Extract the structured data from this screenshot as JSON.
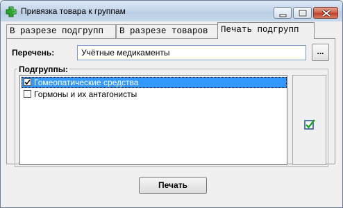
{
  "window": {
    "title": "Привязка товара к группам"
  },
  "tabs": [
    {
      "label": "В разрезе подгрупп"
    },
    {
      "label": "В разрезе товаров"
    },
    {
      "label": "Печать подгрупп",
      "active": true
    }
  ],
  "perechen": {
    "label": "Перечень:",
    "value": "Учётные медикаменты",
    "browse_label": "..."
  },
  "subgroups": {
    "label": "Подгруппы:",
    "items": [
      {
        "label": "Гомеопатические средства",
        "checked": true,
        "selected": true
      },
      {
        "label": "Гормоны и их антагонисты",
        "checked": false,
        "selected": false
      }
    ]
  },
  "print_button": {
    "label": "Печать"
  },
  "colors": {
    "selection": "#3399ff",
    "close_button": "#c0412a",
    "app_icon": "#2aa52a"
  },
  "icons": {
    "app": "green-cross-icon",
    "check_all": "check-all-icon"
  }
}
